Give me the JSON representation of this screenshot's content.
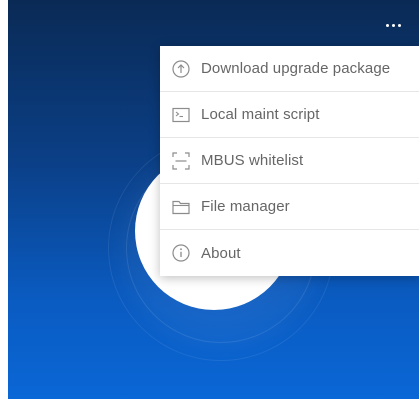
{
  "header": {
    "more_menu_icon": "more-horizontal-icon"
  },
  "menu": {
    "items": [
      {
        "label": "Download upgrade package",
        "icon": "upload-circle-icon"
      },
      {
        "label": "Local maint script",
        "icon": "terminal-icon"
      },
      {
        "label": "MBUS whitelist",
        "icon": "scan-frame-icon"
      },
      {
        "label": "File manager",
        "icon": "folder-icon"
      },
      {
        "label": "About",
        "icon": "info-circle-icon"
      }
    ]
  },
  "colors": {
    "background_top": "#0a2a55",
    "background_bottom": "#0a67d6",
    "menu_background": "#ffffff",
    "menu_text": "#666666",
    "icon_stroke": "#8c8c8c"
  }
}
